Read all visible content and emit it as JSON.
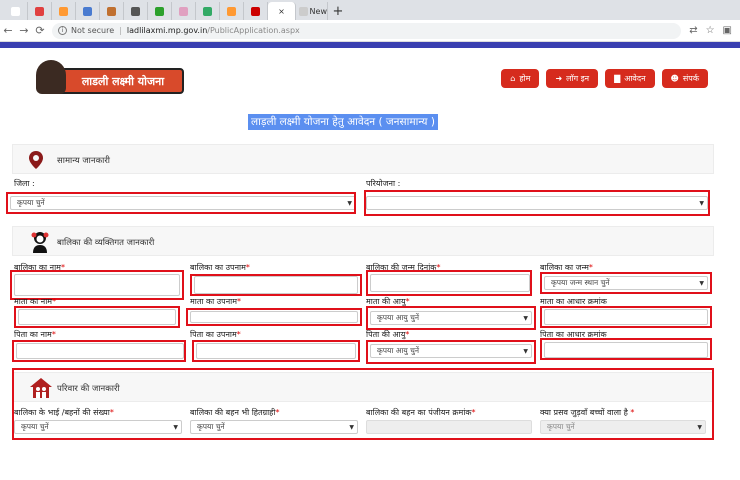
{
  "browser": {
    "tabs": [
      {
        "color": "#ffffff"
      },
      {
        "color": "#e04040"
      },
      {
        "color": "#ff9933"
      },
      {
        "color": "#4a7bd0"
      },
      {
        "color": "#c07030"
      },
      {
        "color": "#555555"
      },
      {
        "color": "#2ca02c"
      },
      {
        "color": "#e0a0c0"
      },
      {
        "color": "#33aa66"
      },
      {
        "color": "#ff9933"
      },
      {
        "color": "#cc0000"
      }
    ],
    "new_tab_label": "New",
    "url_status": "Not secure",
    "url_host": "ladlilaxmi.mp.gov.in",
    "url_path": "/PublicApplication.aspx"
  },
  "site": {
    "logo_text": "लाडली लक्ष्मी योजना",
    "nav": [
      {
        "icon": "home-icon",
        "glyph": "⌂",
        "label": "होम"
      },
      {
        "icon": "login-icon",
        "glyph": "➜",
        "label": "लॉग इन"
      },
      {
        "icon": "document-icon",
        "glyph": "▇",
        "label": "आवेदन"
      },
      {
        "icon": "contact-icon",
        "glyph": "☻",
        "label": "संपर्क"
      }
    ]
  },
  "page_title": "लाड़ली लक्ष्मी योजना हेतु आवेदन ( जनसामान्य )",
  "general": {
    "title": "सामान्य जानकारी",
    "district_label": "जिला :",
    "district_value": "कृपया चुनें",
    "project_label": "परियोजना :",
    "project_value": ""
  },
  "personal": {
    "title": "बालिका की व्यक्तिगत जानकारी",
    "girl_name": "बालिका का नाम",
    "girl_surname": "बालिका का उपनाम",
    "dob": "बालिका की जन्म दिनांक",
    "birth_place": "बालिका का जन्म",
    "birth_place_value": "कृपया जन्म स्थान चुनें",
    "mother_name": "माता का नाम",
    "mother_surname": "माता का उपनाम",
    "mother_age": "माता की आयु",
    "mother_age_value": "कृपया आयु चुनें",
    "mother_aadhaar": "माता का आधार क्रमांक",
    "father_name": "पिता का नाम",
    "father_surname": "पिता का उपनाम",
    "father_age": "पिता की आयु",
    "father_age_value": "कृपया आयु चुनें",
    "father_aadhaar": "पिता का आधार क्रमांक",
    "required_mark": "*"
  },
  "family": {
    "title": "परिवार की जानकारी",
    "siblings": "बालिका के भाई /बहनों की संख्या",
    "sister_beneficiary": "बालिका की बहन भी हितग्राही",
    "sister_reg": "बालिका की बहन का पंजीयन क्रमांक",
    "twins": "क्या प्रसव जुड़वाँ बच्चों वाला है",
    "select_value": "कृपया चुनें"
  },
  "colors": {
    "accent": "#d62b1d",
    "highlight": "#e0101a",
    "title_bg": "#5b8ff0"
  }
}
